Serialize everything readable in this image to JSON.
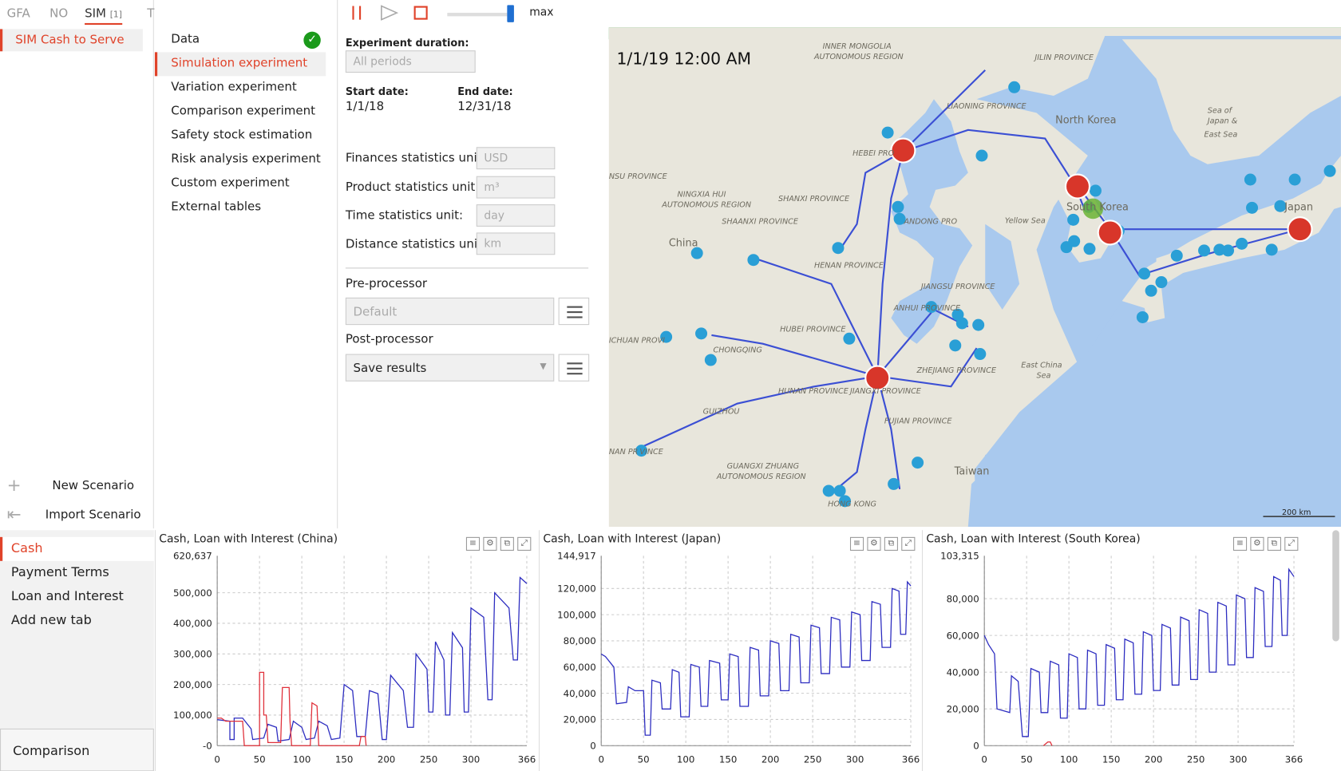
{
  "panel_tabs": [
    {
      "label": "GFA"
    },
    {
      "label": "NO"
    },
    {
      "label": "SIM",
      "badge": "[1]"
    },
    {
      "label": "T"
    }
  ],
  "scenario": {
    "name": "SIM Cash to Serve"
  },
  "actions": {
    "new": "New Scenario",
    "import": "Import Scenario",
    "new_icon": "plus-icon",
    "import_icon": "import-arrow-icon"
  },
  "nav": {
    "items": [
      "Data",
      "Simulation experiment",
      "Variation experiment",
      "Comparison experiment",
      "Safety stock estimation",
      "Risk analysis experiment",
      "Custom experiment",
      "External tables"
    ],
    "active": 1,
    "data_status": "check-icon"
  },
  "toolbar": {
    "speed_label": "max",
    "icons": [
      "pause-icon",
      "play-icon",
      "stop-icon"
    ]
  },
  "settings": {
    "duration_label": "Experiment duration:",
    "duration_value": "All periods",
    "start_label": "Start date:",
    "start_value": "1/1/18",
    "end_label": "End date:",
    "end_value": "12/31/18",
    "finance_label": "Finances statistics unit:",
    "finance_value": "USD",
    "product_label": "Product statistics unit:",
    "product_value": "m³",
    "time_label": "Time statistics unit:",
    "time_value": "day",
    "distance_label": "Distance statistics unit:",
    "distance_value": "km",
    "pre_label": "Pre-processor",
    "pre_value": "Default",
    "post_label": "Post-processor",
    "post_value": "Save results"
  },
  "map": {
    "time": "1/1/19 12:00 AM",
    "scale": "200 km",
    "labels": [
      "INNER MONGOLIA",
      "AUTONOMOUS REGION",
      "JILIN PROVINCE",
      "LIAONING PROVINCE",
      "North Korea",
      "Sea of",
      "Japan &",
      "East Sea",
      "HEBEI PRO",
      "NSU PROVINCE",
      "NINGXIA HUI",
      "AUTONOMOUS REGION",
      "SHANXI PROVINCE",
      "SHAANXI PROVINCE",
      "ANDONG PRO",
      "Yellow Sea",
      "South Korea",
      "Japan",
      "China",
      "HENAN PROVINCE",
      "JIANGSU PROVINCE",
      "ANHUI PROVINCE",
      "HUBEI PROVINCE",
      "ICHUAN PROVI",
      "CHONGQING",
      "HUNAN PROVINCE",
      "JIANGXI PROVINCE",
      "ZHEJIANG PROVINCE",
      "East China",
      "Sea",
      "GUIZHOU",
      "FUJIAN PROVINCE",
      "NAN PR",
      "VINCE",
      "GUANGXI ZHUANG",
      "AUTONOMOUS REGION",
      "Taiwan",
      "HONG KONG"
    ],
    "colors": {
      "water": "#a9c9ee",
      "land": "#e8e6dc",
      "route": "#3b4fd4",
      "site": "#d8362a",
      "customer": "#2a9fd6",
      "bar": "#2ea836"
    }
  },
  "bottom_tabs": {
    "items": [
      "Cash",
      "Payment Terms",
      "Loan and Interest",
      "Add new tab"
    ],
    "active": 0,
    "comparison": "Comparison"
  },
  "chart_data": [
    {
      "type": "line",
      "title": "Cash, Loan with Interest (China)",
      "ymax_label": "620,637",
      "ylim": [
        0,
        620637
      ],
      "xlim": [
        0,
        366
      ],
      "xticks": [
        "0",
        "50",
        "100",
        "150",
        "200",
        "250",
        "300",
        "366"
      ],
      "yticks": [
        "-0",
        "100,000",
        "200,000",
        "300,000",
        "400,000",
        "500,000"
      ],
      "series": [
        {
          "color": "#2c2cc0",
          "values": [
            [
              0,
              85000
            ],
            [
              15,
              80000
            ],
            [
              15,
              20000
            ],
            [
              20,
              20000
            ],
            [
              20,
              90000
            ],
            [
              30,
              90000
            ],
            [
              40,
              55000
            ],
            [
              42,
              20000
            ],
            [
              55,
              25000
            ],
            [
              60,
              70000
            ],
            [
              70,
              60000
            ],
            [
              72,
              15000
            ],
            [
              85,
              20000
            ],
            [
              90,
              80000
            ],
            [
              95,
              70000
            ],
            [
              100,
              60000
            ],
            [
              105,
              20000
            ],
            [
              115,
              25000
            ],
            [
              120,
              80000
            ],
            [
              130,
              65000
            ],
            [
              135,
              20000
            ],
            [
              145,
              25000
            ],
            [
              150,
              200000
            ],
            [
              160,
              180000
            ],
            [
              165,
              30000
            ],
            [
              175,
              30000
            ],
            [
              180,
              180000
            ],
            [
              190,
              170000
            ],
            [
              195,
              20000
            ],
            [
              200,
              20000
            ],
            [
              205,
              230000
            ],
            [
              220,
              180000
            ],
            [
              225,
              60000
            ],
            [
              232,
              60000
            ],
            [
              235,
              300000
            ],
            [
              248,
              250000
            ],
            [
              250,
              110000
            ],
            [
              255,
              110000
            ],
            [
              258,
              340000
            ],
            [
              268,
              280000
            ],
            [
              270,
              100000
            ],
            [
              275,
              100000
            ],
            [
              278,
              370000
            ],
            [
              290,
              320000
            ],
            [
              292,
              110000
            ],
            [
              297,
              110000
            ],
            [
              300,
              450000
            ],
            [
              315,
              420000
            ],
            [
              320,
              150000
            ],
            [
              325,
              150000
            ],
            [
              328,
              500000
            ],
            [
              345,
              450000
            ],
            [
              350,
              280000
            ],
            [
              355,
              280000
            ],
            [
              358,
              550000
            ],
            [
              366,
              530000
            ]
          ]
        },
        {
          "color": "#e0303a",
          "values": [
            [
              0,
              90000
            ],
            [
              5,
              90000
            ],
            [
              10,
              80000
            ],
            [
              15,
              80000
            ],
            [
              20,
              80000
            ],
            [
              28,
              80000
            ],
            [
              30,
              80000
            ],
            [
              32,
              0
            ],
            [
              50,
              0
            ],
            [
              50,
              240000
            ],
            [
              55,
              240000
            ],
            [
              55,
              100000
            ],
            [
              58,
              100000
            ],
            [
              60,
              10000
            ],
            [
              75,
              10000
            ],
            [
              77,
              190000
            ],
            [
              85,
              190000
            ],
            [
              86,
              80000
            ],
            [
              88,
              0
            ],
            [
              110,
              0
            ],
            [
              112,
              140000
            ],
            [
              118,
              130000
            ],
            [
              120,
              0
            ],
            [
              150,
              0
            ],
            [
              155,
              0
            ],
            [
              168,
              0
            ],
            [
              170,
              30000
            ],
            [
              175,
              30000
            ],
            [
              176,
              0
            ]
          ]
        }
      ]
    },
    {
      "type": "line",
      "title": "Cash, Loan with Interest (Japan)",
      "ymax_label": "144,917",
      "ylim": [
        0,
        144917
      ],
      "xlim": [
        0,
        366
      ],
      "xticks": [
        "0",
        "50",
        "100",
        "150",
        "200",
        "250",
        "300",
        "366"
      ],
      "yticks": [
        "0",
        "20,000",
        "40,000",
        "60,000",
        "80,000",
        "100,000",
        "120,000"
      ],
      "series": [
        {
          "color": "#2c2cc0",
          "values": [
            [
              0,
              70000
            ],
            [
              5,
              68000
            ],
            [
              15,
              60000
            ],
            [
              18,
              32000
            ],
            [
              30,
              33000
            ],
            [
              32,
              45000
            ],
            [
              40,
              42000
            ],
            [
              50,
              42000
            ],
            [
              52,
              8000
            ],
            [
              58,
              8000
            ],
            [
              60,
              50000
            ],
            [
              70,
              48000
            ],
            [
              72,
              28000
            ],
            [
              82,
              28000
            ],
            [
              84,
              58000
            ],
            [
              92,
              56000
            ],
            [
              94,
              22000
            ],
            [
              104,
              22000
            ],
            [
              106,
              62000
            ],
            [
              116,
              60000
            ],
            [
              118,
              30000
            ],
            [
              126,
              30000
            ],
            [
              128,
              65000
            ],
            [
              140,
              63000
            ],
            [
              142,
              35000
            ],
            [
              150,
              35000
            ],
            [
              152,
              70000
            ],
            [
              162,
              68000
            ],
            [
              164,
              30000
            ],
            [
              174,
              30000
            ],
            [
              176,
              75000
            ],
            [
              186,
              73000
            ],
            [
              188,
              38000
            ],
            [
              198,
              38000
            ],
            [
              200,
              80000
            ],
            [
              210,
              78000
            ],
            [
              212,
              42000
            ],
            [
              222,
              42000
            ],
            [
              224,
              85000
            ],
            [
              234,
              83000
            ],
            [
              236,
              48000
            ],
            [
              246,
              48000
            ],
            [
              248,
              92000
            ],
            [
              258,
              90000
            ],
            [
              260,
              55000
            ],
            [
              270,
              55000
            ],
            [
              272,
              98000
            ],
            [
              282,
              96000
            ],
            [
              284,
              60000
            ],
            [
              294,
              60000
            ],
            [
              296,
              102000
            ],
            [
              306,
              100000
            ],
            [
              308,
              65000
            ],
            [
              318,
              65000
            ],
            [
              320,
              110000
            ],
            [
              330,
              108000
            ],
            [
              332,
              75000
            ],
            [
              342,
              75000
            ],
            [
              344,
              120000
            ],
            [
              352,
              118000
            ],
            [
              354,
              85000
            ],
            [
              360,
              85000
            ],
            [
              362,
              125000
            ],
            [
              366,
              122000
            ]
          ]
        }
      ]
    },
    {
      "type": "line",
      "title": "Cash, Loan with Interest (South Korea)",
      "ymax_label": "103,315",
      "ylim": [
        0,
        103315
      ],
      "xlim": [
        0,
        366
      ],
      "xticks": [
        "0",
        "50",
        "100",
        "150",
        "200",
        "250",
        "300",
        "366"
      ],
      "yticks": [
        "0",
        "20,000",
        "40,000",
        "60,000",
        "80,000"
      ],
      "series": [
        {
          "color": "#2c2cc0",
          "values": [
            [
              0,
              60000
            ],
            [
              5,
              55000
            ],
            [
              12,
              50000
            ],
            [
              15,
              20000
            ],
            [
              30,
              18000
            ],
            [
              32,
              38000
            ],
            [
              40,
              35000
            ],
            [
              45,
              5000
            ],
            [
              52,
              5000
            ],
            [
              55,
              42000
            ],
            [
              65,
              40000
            ],
            [
              67,
              18000
            ],
            [
              75,
              18000
            ],
            [
              78,
              46000
            ],
            [
              88,
              44000
            ],
            [
              90,
              15000
            ],
            [
              98,
              15000
            ],
            [
              100,
              50000
            ],
            [
              110,
              48000
            ],
            [
              112,
              20000
            ],
            [
              120,
              20000
            ],
            [
              122,
              52000
            ],
            [
              132,
              50000
            ],
            [
              134,
              22000
            ],
            [
              142,
              22000
            ],
            [
              144,
              55000
            ],
            [
              154,
              53000
            ],
            [
              156,
              25000
            ],
            [
              164,
              25000
            ],
            [
              166,
              58000
            ],
            [
              176,
              56000
            ],
            [
              178,
              28000
            ],
            [
              186,
              28000
            ],
            [
              188,
              62000
            ],
            [
              198,
              60000
            ],
            [
              200,
              30000
            ],
            [
              208,
              30000
            ],
            [
              210,
              66000
            ],
            [
              220,
              64000
            ],
            [
              222,
              33000
            ],
            [
              230,
              33000
            ],
            [
              232,
              70000
            ],
            [
              242,
              68000
            ],
            [
              244,
              36000
            ],
            [
              252,
              36000
            ],
            [
              254,
              74000
            ],
            [
              264,
              72000
            ],
            [
              266,
              40000
            ],
            [
              274,
              40000
            ],
            [
              276,
              78000
            ],
            [
              286,
              76000
            ],
            [
              288,
              44000
            ],
            [
              296,
              44000
            ],
            [
              298,
              82000
            ],
            [
              308,
              80000
            ],
            [
              310,
              48000
            ],
            [
              318,
              48000
            ],
            [
              320,
              86000
            ],
            [
              330,
              84000
            ],
            [
              332,
              54000
            ],
            [
              340,
              54000
            ],
            [
              342,
              92000
            ],
            [
              350,
              90000
            ],
            [
              352,
              60000
            ],
            [
              358,
              60000
            ],
            [
              360,
              96000
            ],
            [
              366,
              92000
            ]
          ]
        },
        {
          "color": "#e0303a",
          "values": [
            [
              70,
              0
            ],
            [
              75,
              2000
            ],
            [
              78,
              2000
            ],
            [
              80,
              0
            ]
          ]
        }
      ]
    }
  ]
}
